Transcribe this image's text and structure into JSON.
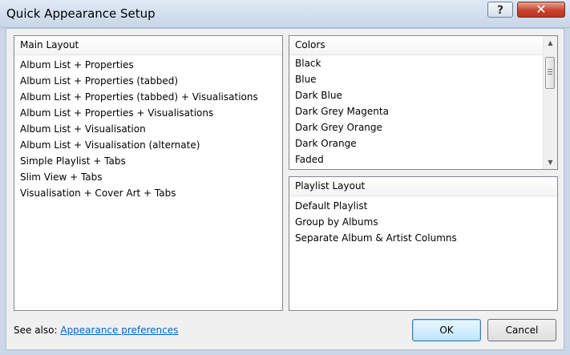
{
  "window": {
    "title": "Quick Appearance Setup",
    "help_label": "?",
    "close_label": "✕"
  },
  "main_layout": {
    "header": "Main Layout",
    "items": [
      "Album List + Properties",
      "Album List + Properties (tabbed)",
      "Album List + Properties (tabbed) + Visualisations",
      "Album List + Properties + Visualisations",
      "Album List + Visualisation",
      "Album List + Visualisation (alternate)",
      "Simple Playlist + Tabs",
      "Slim View + Tabs",
      "Visualisation + Cover Art + Tabs"
    ]
  },
  "colors": {
    "header": "Colors",
    "items": [
      "Black",
      "Blue",
      "Dark Blue",
      "Dark Grey Magenta",
      "Dark Grey Orange",
      "Dark Orange",
      "Faded"
    ]
  },
  "playlist_layout": {
    "header": "Playlist Layout",
    "items": [
      "Default Playlist",
      "Group by Albums",
      "Separate Album & Artist Columns"
    ]
  },
  "footer": {
    "see_also": "See also:",
    "link": "Appearance preferences",
    "ok": "OK",
    "cancel": "Cancel"
  },
  "icons": {
    "scroll_up": "up-arrow-icon",
    "scroll_down": "down-arrow-icon"
  }
}
